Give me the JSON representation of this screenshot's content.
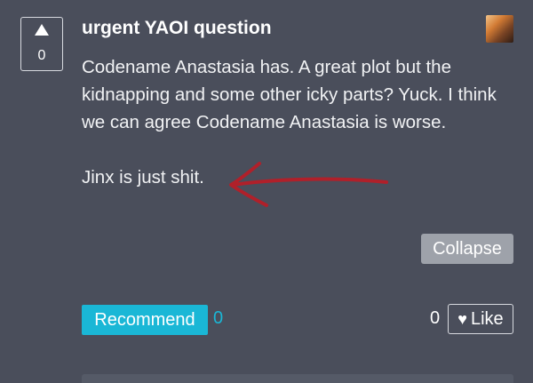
{
  "post": {
    "votes": "0",
    "title": "urgent YAOI question",
    "paragraph1": "Codename Anastasia has. A great plot but the kidnapping and some other icky parts? Yuck. I think we can agree Codename Anastasia is worse.",
    "paragraph2": "Jinx is just shit."
  },
  "actions": {
    "collapse_label": "Collapse",
    "recommend_label": "Recommend",
    "recommend_count": "0",
    "like_count": "0",
    "like_label": "Like",
    "like_icon": "heart-icon",
    "upvote_icon": "triangle-up-icon"
  },
  "colors": {
    "background": "#4a4e5b",
    "recommend": "#1ab7d6",
    "collapse": "#9ea2aa",
    "arrow": "#b0202a"
  }
}
